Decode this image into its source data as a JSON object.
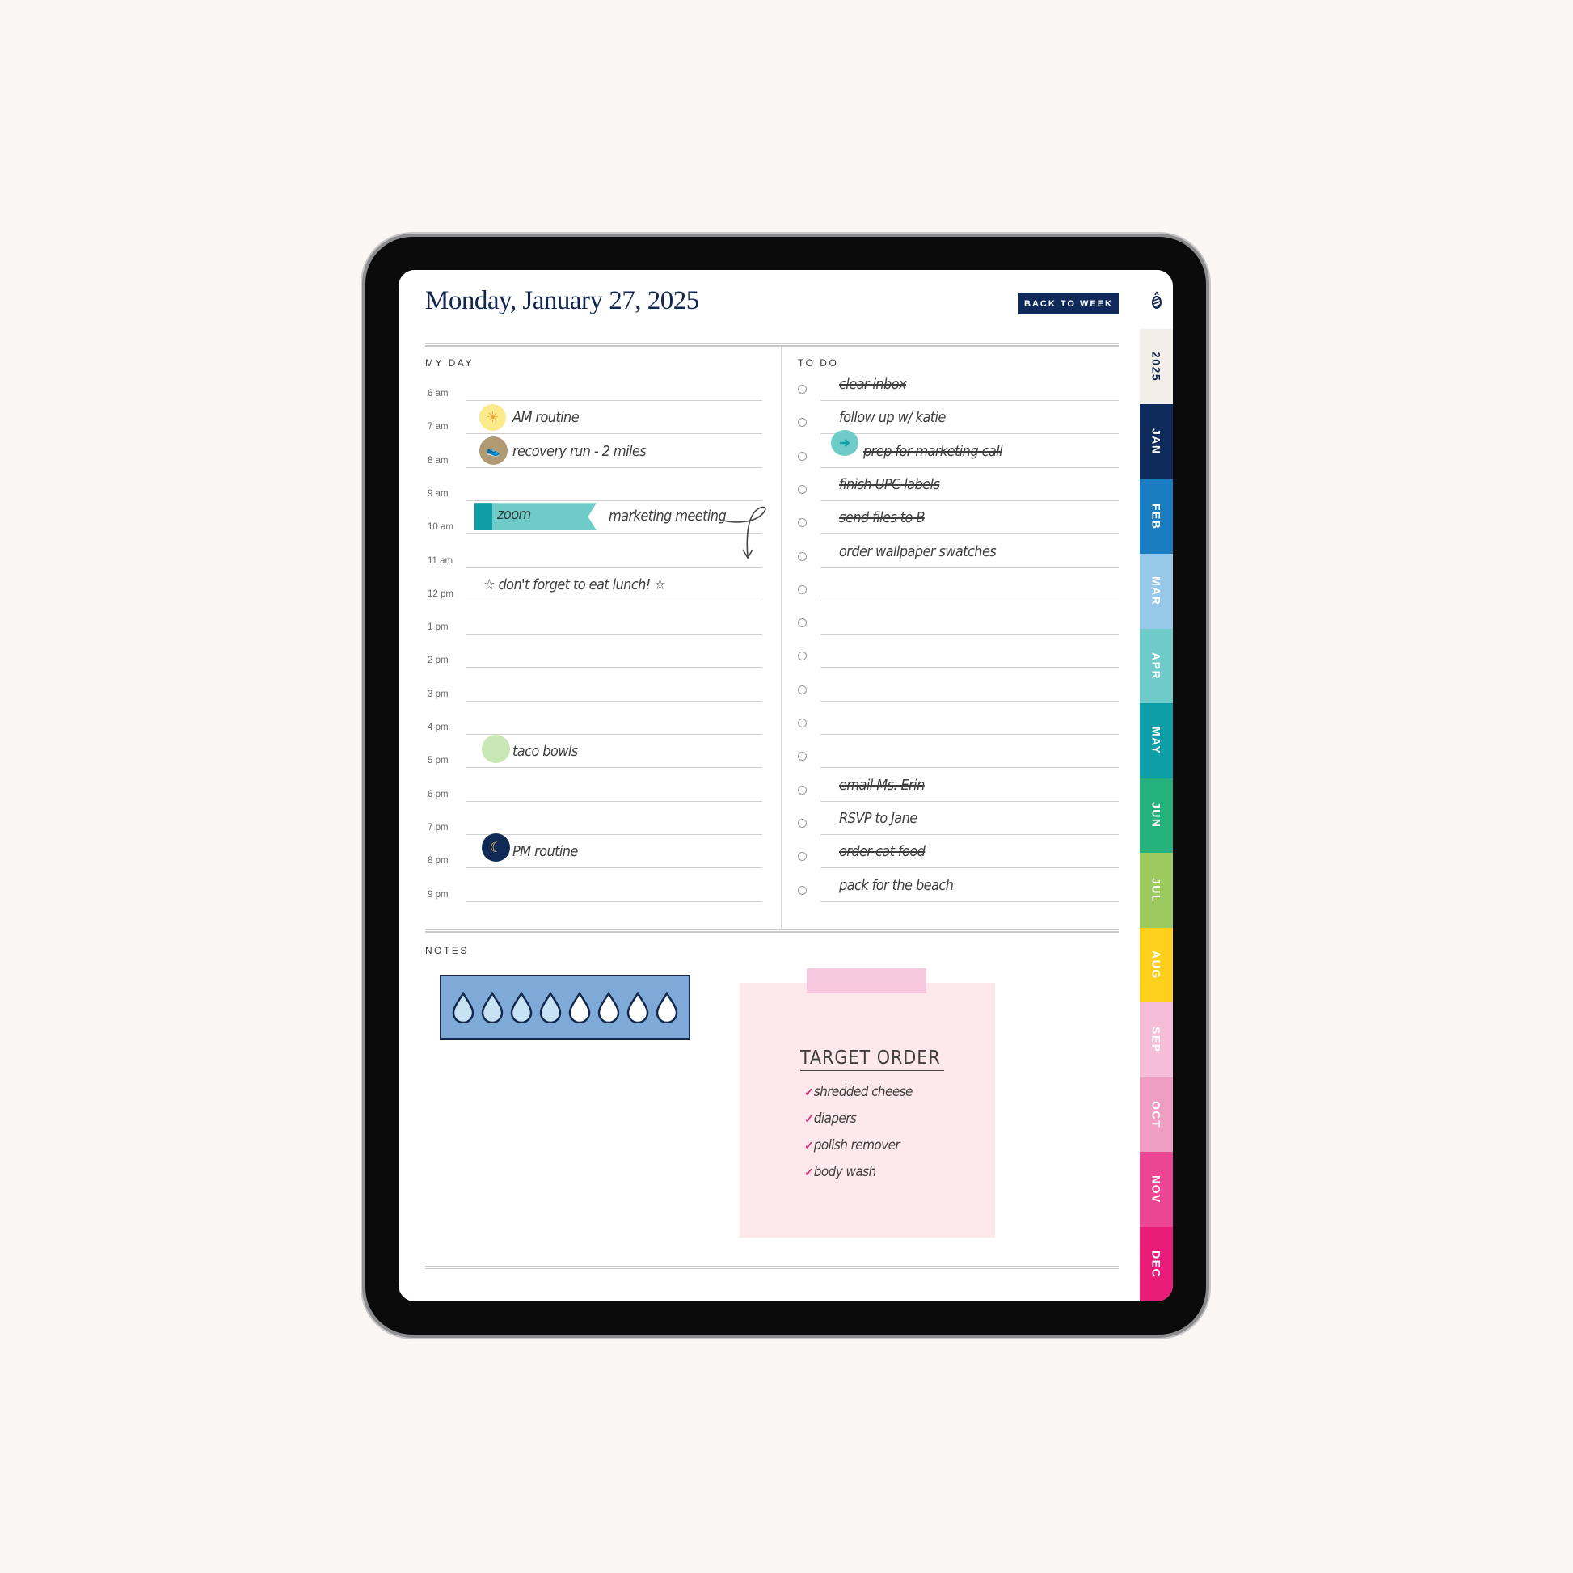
{
  "header": {
    "title": "Monday, January 27, 2025",
    "back_button": "BACK TO WEEK"
  },
  "my_day": {
    "label": "MY DAY",
    "hours": [
      "6 am",
      "7 am",
      "8 am",
      "9 am",
      "10 am",
      "11 am",
      "12 pm",
      "1 pm",
      "2 pm",
      "3 pm",
      "4 pm",
      "5 pm",
      "6 pm",
      "7 pm",
      "8 pm",
      "9 pm"
    ],
    "entries": [
      {
        "hour": "7 am",
        "text": "AM routine",
        "sticker": "sun-icon"
      },
      {
        "hour": "8 am",
        "text": "recovery run - 2 miles",
        "sticker": "running-shoe-icon"
      },
      {
        "hour": "10 am",
        "banner": "zoom",
        "text": "marketing meeting",
        "sticker": "zoom-banner"
      },
      {
        "hour": "12 pm",
        "text": "☆ don't forget to eat lunch! ☆"
      },
      {
        "hour": "5 pm",
        "text": "taco bowls",
        "sticker": "green-dot"
      },
      {
        "hour": "8 pm",
        "text": "PM routine",
        "sticker": "moon-icon"
      }
    ]
  },
  "todo": {
    "label": "TO DO",
    "items": [
      {
        "text": "clear inbox",
        "done": true
      },
      {
        "text": "follow up w/ katie",
        "done": false
      },
      {
        "text": "prep for marketing call",
        "done": true,
        "sticker": "arrow-icon"
      },
      {
        "text": "finish UPC labels",
        "done": true
      },
      {
        "text": "send files to B",
        "done": true
      },
      {
        "text": "order wallpaper swatches",
        "done": false
      },
      {
        "text": "",
        "done": false
      },
      {
        "text": "",
        "done": false
      },
      {
        "text": "",
        "done": false
      },
      {
        "text": "",
        "done": false
      },
      {
        "text": "",
        "done": false
      },
      {
        "text": "",
        "done": false
      },
      {
        "text": "email Ms. Erin",
        "done": true
      },
      {
        "text": "RSVP to Jane",
        "done": false
      },
      {
        "text": "order cat food",
        "done": true
      },
      {
        "text": "pack for the beach",
        "done": false
      }
    ]
  },
  "notes": {
    "label": "NOTES",
    "water_tracker": {
      "total": 8,
      "filled": 4
    },
    "sticky_note": {
      "title": "TARGET ORDER",
      "items": [
        "shredded cheese",
        "diapers",
        "polish remover",
        "body wash"
      ],
      "check_color": "#e0307a"
    }
  },
  "tabs": [
    {
      "label": "",
      "icon": "pineapple-logo-icon",
      "color": "#ffffff"
    },
    {
      "label": "2025",
      "color": "#f3efe8",
      "text_color": "#13264f"
    },
    {
      "label": "JAN",
      "color": "#0f2b5b"
    },
    {
      "label": "FEB",
      "color": "#1a7dc2"
    },
    {
      "label": "MAR",
      "color": "#96c9e9"
    },
    {
      "label": "APR",
      "color": "#6fcbc7"
    },
    {
      "label": "MAY",
      "color": "#0e9ea7"
    },
    {
      "label": "JUN",
      "color": "#24b17b"
    },
    {
      "label": "JUL",
      "color": "#9dca5f"
    },
    {
      "label": "AUG",
      "color": "#fdd01d"
    },
    {
      "label": "SEP",
      "color": "#f6bdd9"
    },
    {
      "label": "OCT",
      "color": "#f09dc3"
    },
    {
      "label": "NOV",
      "color": "#ec4594"
    },
    {
      "label": "DEC",
      "color": "#e91c7a"
    }
  ],
  "colors": {
    "navy": "#0f2a5a",
    "teal": "#6fcbc7",
    "tape_pink": "#f7c6dc",
    "note_pink": "#fde9ec"
  }
}
